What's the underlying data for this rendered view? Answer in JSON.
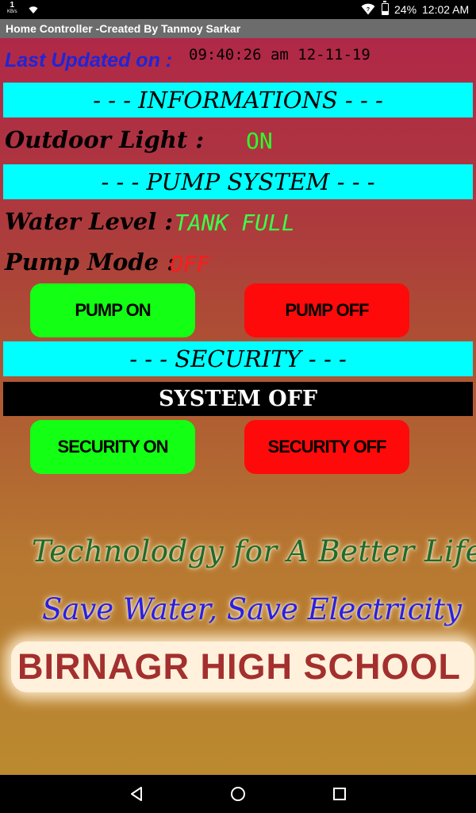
{
  "status_bar": {
    "net_speed": "1",
    "net_unit": "KB/s",
    "battery_percent": "24%",
    "battery_level": 0.24,
    "time": "12:02 AM",
    "icons": [
      "wifi-icon",
      "battery-icon"
    ]
  },
  "title_bar": {
    "title": "Home Controller -Created By Tanmoy Sarkar"
  },
  "last_updated": {
    "label": "Last Updated on :",
    "value": "09:40:26 am 12-11-19"
  },
  "sections": {
    "informations": "- - - INFORMATIONS - - -",
    "pump_system": "- - - PUMP SYSTEM - - -",
    "security": "- - - SECURITY - - -"
  },
  "informations": {
    "outdoor_light_label": "Outdoor Light :",
    "outdoor_light_value": "ON"
  },
  "pump": {
    "water_level_label": "Water Level :",
    "water_level_value": "TANK FULL",
    "mode_label": "Pump Mode :",
    "mode_value": "OFF",
    "on_button": "PUMP ON",
    "off_button": "PUMP OFF"
  },
  "security": {
    "status": "SYSTEM OFF",
    "on_button": "SECURITY ON",
    "off_button": "SECURITY OFF"
  },
  "footer": {
    "slogan_1": "Technolodgy for A Better Life",
    "slogan_2": "Save Water, Save Electricity",
    "school": "BIRNAGR HIGH SCHOOL"
  },
  "colors": {
    "banner": "#00ffff",
    "button_on": "#13ff13",
    "button_off": "#ff0a0a",
    "status_on": "#2bff2b",
    "status_off": "#ff1a1a",
    "last_updated_label": "#1f25d8"
  }
}
